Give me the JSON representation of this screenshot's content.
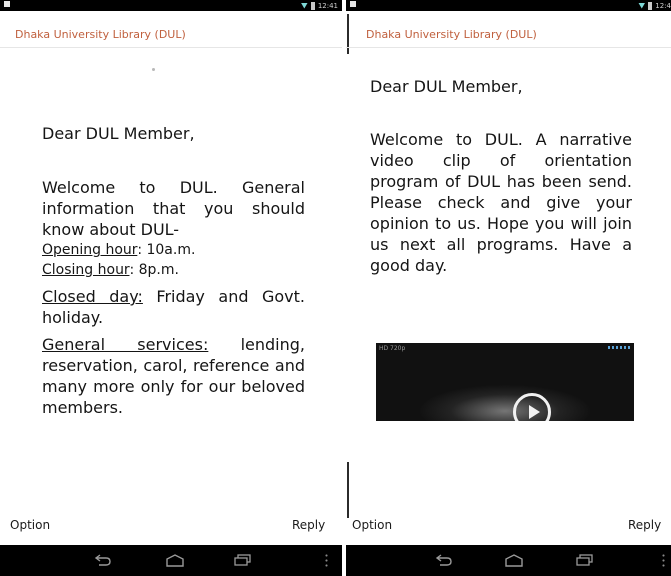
{
  "colors": {
    "title": "#c0603e",
    "status_bar": "#000000",
    "nav_bar": "#000000",
    "wifi": "#7fd8d6",
    "text": "#151515"
  },
  "left_phone": {
    "status_time": "12:41",
    "app_title": "Dhaka University Library (DUL)",
    "greeting": "Dear DUL Member,",
    "intro": "Welcome to DUL. General information that you should know about DUL-",
    "opening_label": "Opening hour",
    "opening_value": ": 10a.m.",
    "closing_label": "Closing hour",
    "closing_value": ": 8p.m.",
    "closed_label": "Closed day:",
    "closed_value": " Friday and Govt. holiday.",
    "services_label": "General services:",
    "services_value": " lending, reservation, carol, reference and many more only for our beloved members.",
    "option_label": "Option",
    "reply_label": "Reply",
    "nav_icons": [
      "back-icon",
      "home-icon",
      "recent-apps-icon",
      "menu-icon"
    ]
  },
  "right_phone": {
    "status_time": "12:4",
    "app_title": "Dhaka University Library (DUL)",
    "greeting": "Dear DUL Member,",
    "message": "Welcome to DUL. A narrative video clip of orientation program of DUL has been send. Please check and give your opinion to us. Hope you will join us next all programs. Have a good day.",
    "video_label": "HD 720p",
    "video_icon": "play-icon",
    "option_label": "Option",
    "reply_label": "Reply",
    "nav_icons": [
      "back-icon",
      "home-icon",
      "recent-apps-icon",
      "menu-icon"
    ]
  }
}
